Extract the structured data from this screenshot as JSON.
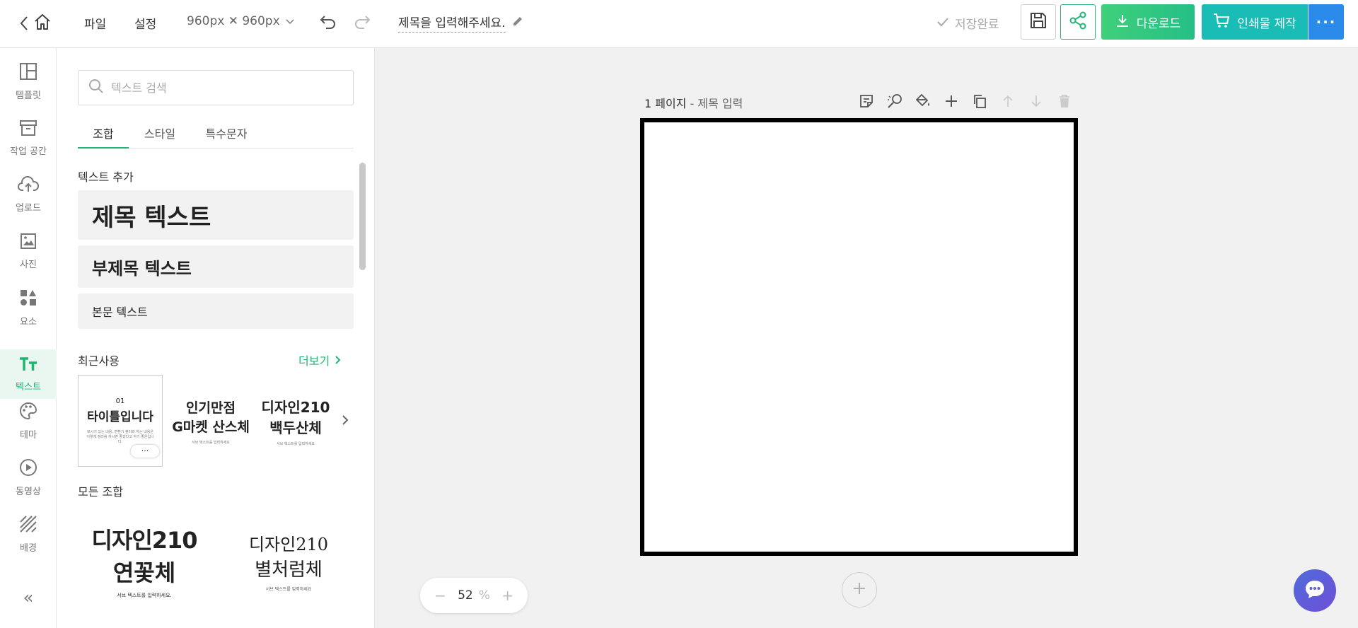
{
  "topbar": {
    "menu_file": "파일",
    "menu_settings": "설정",
    "size_label": "960px ✕ 960px",
    "title": "제목을 입력해주세요.",
    "save_status": "저장완료",
    "download_label": "다운로드",
    "print_label": "인쇄물 제작",
    "more_label": "···"
  },
  "nav": {
    "items": [
      {
        "label": "템플릿"
      },
      {
        "label": "작업 공간"
      },
      {
        "label": "업로드"
      },
      {
        "label": "사진"
      },
      {
        "label": "요소"
      },
      {
        "label": "텍스트"
      },
      {
        "label": "테마"
      },
      {
        "label": "동영상"
      },
      {
        "label": "배경"
      }
    ],
    "collapse_label": "«"
  },
  "panel": {
    "search_placeholder": "텍스트 검색",
    "tabs": [
      {
        "label": "조합"
      },
      {
        "label": "스타일"
      },
      {
        "label": "특수문자"
      }
    ],
    "add_text_title": "텍스트 추가",
    "heading_text": "제목 텍스트",
    "subheading_text": "부제목 텍스트",
    "body_text": "본문 텍스트",
    "recent_title": "최근사용",
    "more_link": "더보기",
    "recent": [
      {
        "small": "01",
        "main": "타이틀입니다",
        "desc": "보시기 있는 내용, 변환기 불러와 하는 내용은 이렇게 정리를 하시면 좋겠다고 하기 좋은입니다."
      },
      {
        "main": "인기만점",
        "main2": "G마켓 산스체",
        "desc": "서브 텍스트를 입력하세요"
      },
      {
        "main": "디자인210",
        "main2": "백두산체",
        "desc": "서브 텍스트를 입력하세요"
      }
    ],
    "thumb_more": "···",
    "all_title": "모든 조합",
    "all": [
      {
        "main": "디자인210",
        "main2": "연꽃체",
        "desc": "서브 텍스트를 입력하세요."
      },
      {
        "main": "디자인210",
        "main2": "별처럼체",
        "desc": "서브 텍스트를 입력하세요"
      }
    ]
  },
  "canvas": {
    "page_number": "1 페이지",
    "page_sep": " - ",
    "page_title": "제목 입력"
  },
  "zoom": {
    "minus": "−",
    "value": "52",
    "unit": "%",
    "plus": "+"
  },
  "colors": {
    "accent": "#21b573",
    "print": "#19bdb6",
    "more": "#2a8bea"
  }
}
